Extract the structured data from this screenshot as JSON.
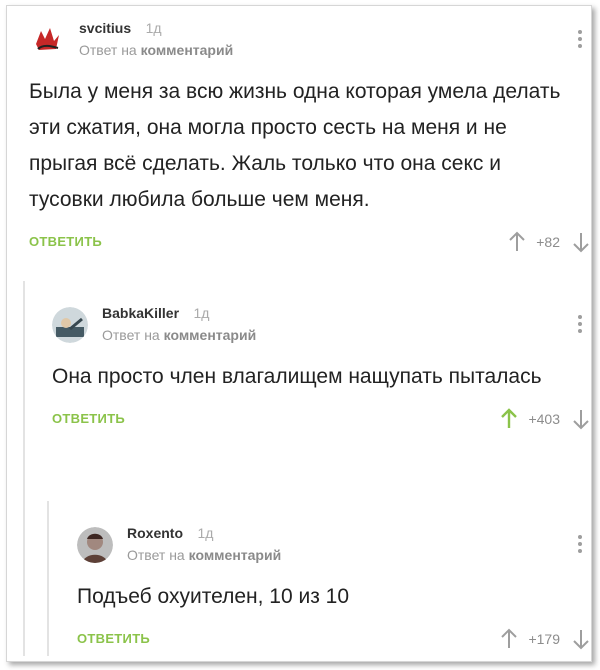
{
  "reply_prefix": "Ответ на",
  "comments": [
    {
      "user": "svcitius",
      "age": "1д",
      "reply_target": "комментарий",
      "text": "Была у меня за всю жизнь одна которая умела делать эти сжатия, она могла просто сесть на меня и не прыгая всё сделать. Жаль только что она секс и тусовки любила больше чем меня.",
      "reply_label": "ОТВЕТИТЬ",
      "score": "+82",
      "upvoted": false
    },
    {
      "user": "BabkaKiller",
      "age": "1д",
      "reply_target": "комментарий",
      "text": "Она просто член влагалищем нащупать пыталась",
      "reply_label": "ОТВЕТИТЬ",
      "score": "+403",
      "upvoted": true
    },
    {
      "user": "Roxento",
      "age": "1д",
      "reply_target": "комментарий",
      "text": "Подъеб охуителен, 10 из 10",
      "reply_label": "ОТВЕТИТЬ",
      "score": "+179",
      "upvoted": false
    }
  ],
  "colors": {
    "accent": "#8bc34a",
    "upvote_active": "#8bc34a",
    "vote_inactive": "#9e9e9e"
  }
}
